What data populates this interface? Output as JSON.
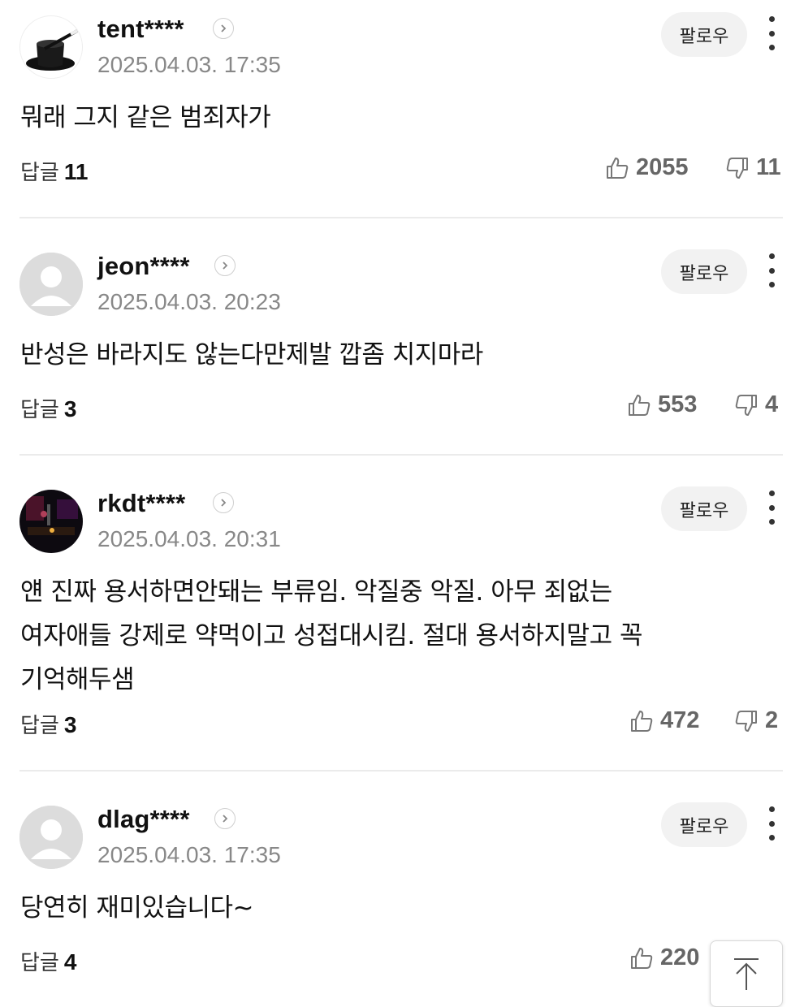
{
  "follow_label": "팔로우",
  "reply_label": "답글",
  "comments": [
    {
      "username": "tent****",
      "date": "2025.04.03. 17:35",
      "text": "뭐래 그지 같은 범죄자가",
      "replies": "11",
      "likes": "2055",
      "dislikes": "11",
      "avatar": "magic-hat"
    },
    {
      "username": "jeon****",
      "date": "2025.04.03. 20:23",
      "text": "반성은 바라지도 않는다만제발 깝좀 치지마라",
      "replies": "3",
      "likes": "553",
      "dislikes": "4",
      "avatar": "default"
    },
    {
      "username": "rkdt****",
      "date": "2025.04.03. 20:31",
      "text_lines": [
        "얜 진짜 용서하면안돼는 부류임. 악질중 악질. 아무 죄없는",
        "여자애들 강제로 약먹이고 성접대시킴. 절대 용서하지말고 꼭",
        "기억해두샘"
      ],
      "replies": "3",
      "likes": "472",
      "dislikes": "2",
      "avatar": "dark-photo"
    },
    {
      "username": "dlag****",
      "date": "2025.04.03. 17:35",
      "text": "당연히 재미있습니다~",
      "replies": "4",
      "likes": "220",
      "avatar": "default"
    }
  ],
  "colors": {
    "date": "#888888",
    "follow_bg": "#f2f2f2",
    "divider": "#ebebeb",
    "vote": "#666666"
  },
  "icons": [
    "chevron-right-icon",
    "more-vertical-icon",
    "thumbs-up-icon",
    "thumbs-down-icon",
    "arrow-up-icon"
  ]
}
